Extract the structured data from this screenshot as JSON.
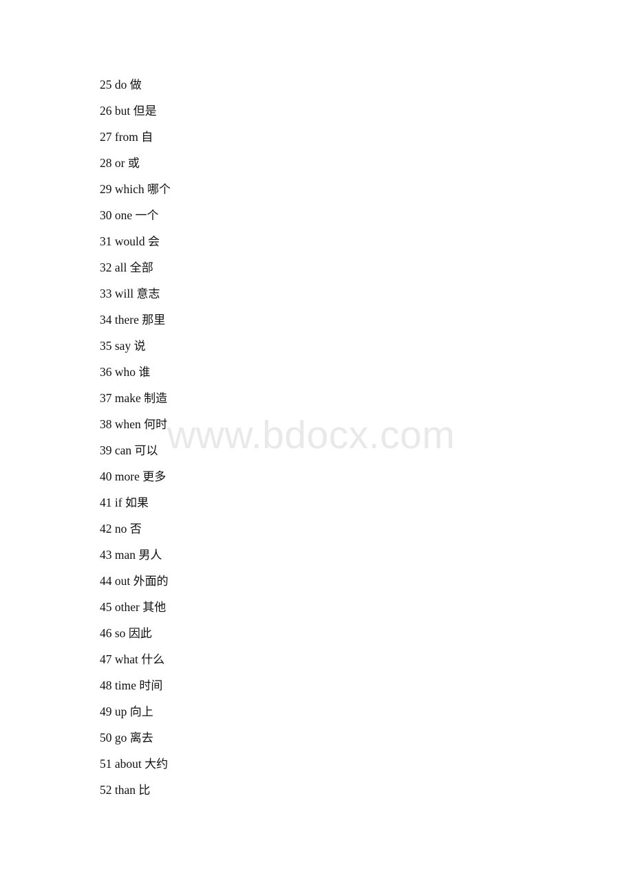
{
  "document": {
    "type": "vocabulary-list",
    "page_background": "#ffffff",
    "text_color": "#111111"
  },
  "watermark": {
    "text": "www.bdocx.com",
    "color": "#e9e9e9"
  },
  "entries": [
    {
      "num": "25",
      "word": "do",
      "cn": "做"
    },
    {
      "num": "26",
      "word": "but",
      "cn": "但是"
    },
    {
      "num": "27",
      "word": "from",
      "cn": "自"
    },
    {
      "num": "28",
      "word": "or",
      "cn": "或"
    },
    {
      "num": "29",
      "word": "which",
      "cn": "哪个"
    },
    {
      "num": "30",
      "word": "one",
      "cn": "一个"
    },
    {
      "num": "31",
      "word": "would",
      "cn": "会"
    },
    {
      "num": "32",
      "word": "all",
      "cn": "全部"
    },
    {
      "num": "33",
      "word": "will",
      "cn": "意志"
    },
    {
      "num": "34",
      "word": "there",
      "cn": "那里"
    },
    {
      "num": "35",
      "word": "say",
      "cn": "说"
    },
    {
      "num": "36",
      "word": "who",
      "cn": "谁"
    },
    {
      "num": "37",
      "word": "make",
      "cn": "制造"
    },
    {
      "num": "38",
      "word": "when",
      "cn": "何时"
    },
    {
      "num": "39",
      "word": "can",
      "cn": "可以"
    },
    {
      "num": "40",
      "word": "more",
      "cn": "更多"
    },
    {
      "num": "41",
      "word": "if",
      "cn": "如果"
    },
    {
      "num": "42",
      "word": "no",
      "cn": "否"
    },
    {
      "num": "43",
      "word": "man",
      "cn": "男人"
    },
    {
      "num": "44",
      "word": "out",
      "cn": "外面的"
    },
    {
      "num": "45",
      "word": "other",
      "cn": "其他"
    },
    {
      "num": "46",
      "word": "so",
      "cn": "因此"
    },
    {
      "num": "47",
      "word": "what",
      "cn": "什么"
    },
    {
      "num": "48",
      "word": "time",
      "cn": "时间"
    },
    {
      "num": "49",
      "word": "up",
      "cn": "向上"
    },
    {
      "num": "50",
      "word": "go",
      "cn": "离去"
    },
    {
      "num": "51",
      "word": "about",
      "cn": "大约"
    },
    {
      "num": "52",
      "word": "than",
      "cn": "比"
    }
  ]
}
